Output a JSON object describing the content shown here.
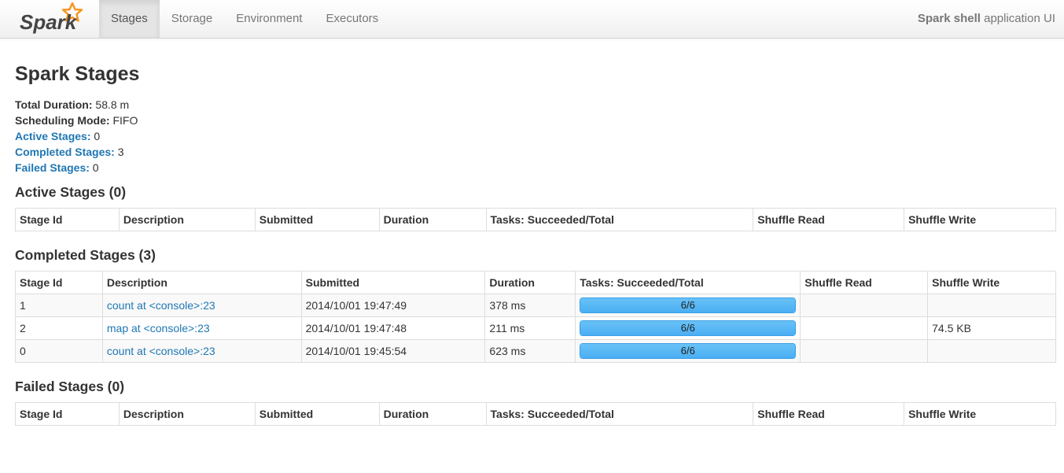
{
  "navbar": {
    "brand": "Spark",
    "tabs": [
      {
        "label": "Stages",
        "active": true
      },
      {
        "label": "Storage",
        "active": false
      },
      {
        "label": "Environment",
        "active": false
      },
      {
        "label": "Executors",
        "active": false
      }
    ],
    "app_name": "Spark shell",
    "app_suffix": " application UI"
  },
  "page": {
    "title": "Spark Stages",
    "summary": {
      "total_duration_label": "Total Duration:",
      "total_duration_value": " 58.8 m",
      "scheduling_mode_label": "Scheduling Mode:",
      "scheduling_mode_value": " FIFO",
      "active_stages_label": "Active Stages:",
      "active_stages_value": " 0",
      "completed_stages_label": "Completed Stages:",
      "completed_stages_value": " 3",
      "failed_stages_label": "Failed Stages:",
      "failed_stages_value": " 0"
    }
  },
  "columns_main": [
    "Stage Id",
    "Description",
    "Submitted",
    "Duration",
    "Tasks: Succeeded/Total",
    "Shuffle Read",
    "Shuffle Write"
  ],
  "active": {
    "heading": "Active Stages (0)"
  },
  "completed": {
    "heading": "Completed Stages (3)",
    "rows": [
      {
        "stage_id": "1",
        "description": "count at <console>:23",
        "submitted": "2014/10/01 19:47:49",
        "duration": "378 ms",
        "tasks": "6/6",
        "progress": 1.0,
        "shuffle_read": "",
        "shuffle_write": ""
      },
      {
        "stage_id": "2",
        "description": "map at <console>:23",
        "submitted": "2014/10/01 19:47:48",
        "duration": "211 ms",
        "tasks": "6/6",
        "progress": 1.0,
        "shuffle_read": "",
        "shuffle_write": "74.5 KB"
      },
      {
        "stage_id": "0",
        "description": "count at <console>:23",
        "submitted": "2014/10/01 19:45:54",
        "duration": "623 ms",
        "tasks": "6/6",
        "progress": 1.0,
        "shuffle_read": "",
        "shuffle_write": ""
      }
    ]
  },
  "failed": {
    "heading": "Failed Stages (0)"
  },
  "colors": {
    "link": "#1f77b4",
    "progress": "#4aaef3",
    "brand_star": "#f7941d"
  }
}
